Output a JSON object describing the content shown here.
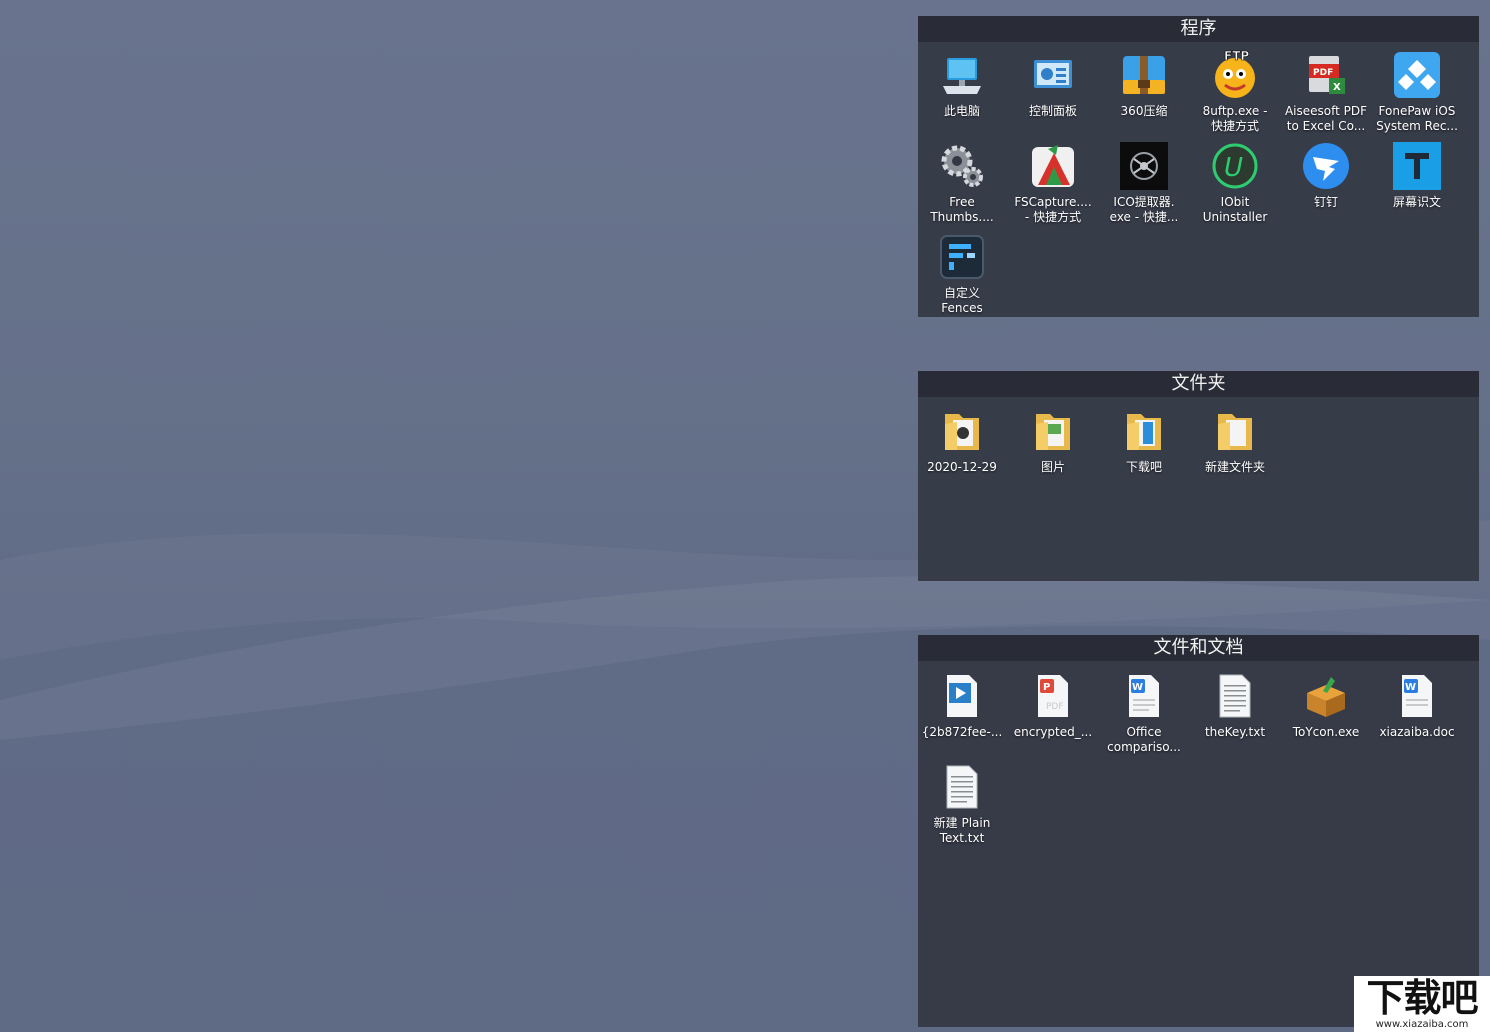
{
  "fences": [
    {
      "title": "程序",
      "items": [
        {
          "label": "此电脑",
          "icon": "computer-icon"
        },
        {
          "label": "控制面板",
          "icon": "control-panel-icon"
        },
        {
          "label": "360压缩",
          "icon": "archive-icon"
        },
        {
          "label": "8uftp.exe -\n快捷方式",
          "icon": "ftp-icon"
        },
        {
          "label": "Aiseesoft PDF\nto Excel Co...",
          "icon": "pdf-excel-icon"
        },
        {
          "label": "FonePaw iOS\nSystem Rec...",
          "icon": "fonepaw-icon"
        },
        {
          "label": "Free\nThumbs....",
          "icon": "gears-icon"
        },
        {
          "label": "FSCapture....\n- 快捷方式",
          "icon": "fscapture-icon"
        },
        {
          "label": "ICO提取器.\nexe - 快捷...",
          "icon": "ico-extractor-icon"
        },
        {
          "label": "IObit\nUninstaller",
          "icon": "iobit-icon"
        },
        {
          "label": "钉钉",
          "icon": "dingtalk-icon"
        },
        {
          "label": "屏幕识文",
          "icon": "text-recognition-icon"
        },
        {
          "label": "自定义\nFences",
          "icon": "fences-icon"
        }
      ]
    },
    {
      "title": "文件夹",
      "items": [
        {
          "label": "2020-12-29",
          "icon": "folder-icon"
        },
        {
          "label": "图片",
          "icon": "folder-icon"
        },
        {
          "label": "下载吧",
          "icon": "folder-icon"
        },
        {
          "label": "新建文件夹",
          "icon": "folder-icon"
        }
      ]
    },
    {
      "title": "文件和文档",
      "items": [
        {
          "label": "{2b872fee-...",
          "icon": "video-file-icon"
        },
        {
          "label": "encrypted_...",
          "icon": "pdf-file-icon"
        },
        {
          "label": "Office\ncompariso...",
          "icon": "word-file-icon"
        },
        {
          "label": "theKey.txt",
          "icon": "text-file-icon"
        },
        {
          "label": "ToYcon.exe",
          "icon": "box-exe-icon"
        },
        {
          "label": "xiazaiba.doc",
          "icon": "word-file-icon"
        },
        {
          "label": "新建 Plain\nText.txt",
          "icon": "text-file-icon"
        }
      ]
    }
  ],
  "watermark": {
    "big": "下载吧",
    "small": "www.xiazaiba.com"
  }
}
